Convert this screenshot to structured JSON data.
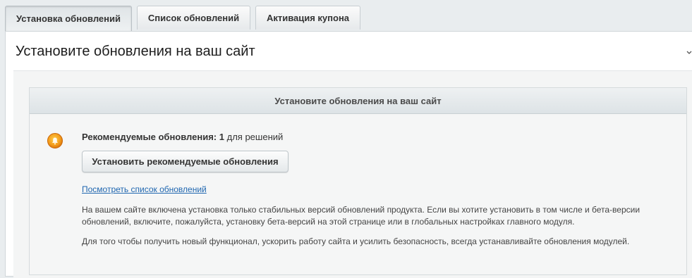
{
  "tabs": [
    {
      "label": "Установка обновлений",
      "active": true
    },
    {
      "label": "Список обновлений",
      "active": false
    },
    {
      "label": "Активация купона",
      "active": false
    }
  ],
  "panel": {
    "title": "Установите обновления на ваш сайт"
  },
  "card": {
    "heading": "Установите обновления на ваш сайт",
    "recommended_label": "Рекомендуемые обновления:",
    "recommended_count": "1",
    "recommended_suffix": "для решений",
    "install_button": "Установить рекомендуемые обновления",
    "view_list_link": "Посмотреть список обновлений",
    "paragraph1": "На вашем сайте включена установка только стабильных версий обновлений продукта. Если вы хотите установить в том числе и бета-версии обновлений, включите, пожалуйста, установку бета-версий на этой странице или в глобальных настройках главного модуля.",
    "paragraph2": "Для того чтобы получить новый функционал, ускорить работу сайта и усилить безопасность, всегда устанавливайте обновления модулей."
  },
  "colors": {
    "link": "#2067b0",
    "warn_icon": "#f5a623"
  },
  "icons": {
    "warning": "warning-bell-icon",
    "collapse": "chevron-down-icon"
  }
}
